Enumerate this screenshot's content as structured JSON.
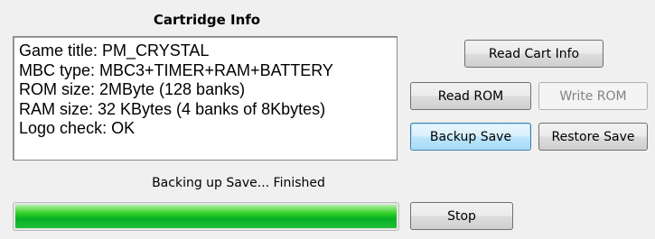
{
  "panel": {
    "title": "Cartridge Info"
  },
  "cart_info": {
    "lines": [
      "Game title: PM_CRYSTAL",
      "MBC type: MBC3+TIMER+RAM+BATTERY",
      "ROM size: 2MByte (128 banks)",
      "RAM size: 32 KBytes (4 banks of 8Kbytes)",
      "Logo check: OK"
    ]
  },
  "buttons": {
    "read_cart_info": "Read Cart Info",
    "read_rom": "Read ROM",
    "write_rom": "Write ROM",
    "backup_save": "Backup Save",
    "restore_save": "Restore Save",
    "stop": "Stop"
  },
  "button_states": {
    "write_rom_enabled": false,
    "backup_save_focused": true
  },
  "status": {
    "text": "Backing up Save... Finished"
  },
  "progress": {
    "percent": 100,
    "color": "#06b025"
  }
}
